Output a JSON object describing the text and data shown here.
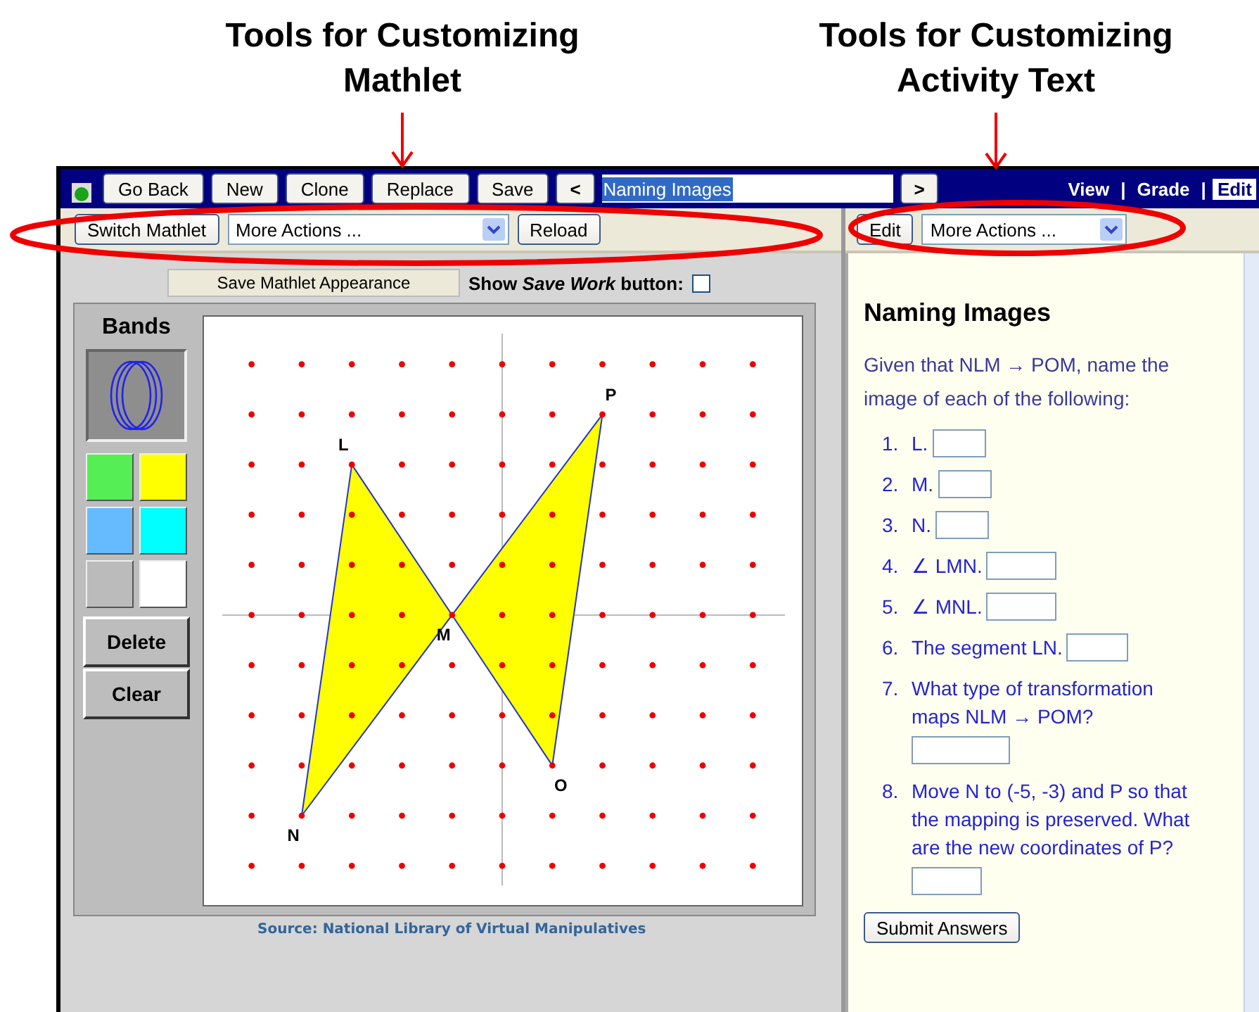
{
  "annotations": [
    {
      "text": "Tools for Customizing Mathlet"
    },
    {
      "text": "Tools for Customizing Activity Text"
    }
  ],
  "nav_bar": {
    "buttons": [
      "Go Back",
      "New",
      "Clone",
      "Replace",
      "Save"
    ],
    "prev": "<",
    "title_field": {
      "value": "Naming Images",
      "selected": true
    },
    "next": ">",
    "links": [
      {
        "label": "View",
        "selected": false
      },
      {
        "label": "Grade",
        "selected": false
      },
      {
        "label": "Edit",
        "selected": true
      }
    ],
    "separator": "|"
  },
  "mathlet_toolbar": {
    "switch_button": "Switch Mathlet",
    "select": "More Actions ...",
    "reload_button": "Reload"
  },
  "activity_toolbar": {
    "edit_button": "Edit",
    "select": "More Actions ..."
  },
  "mathlet": {
    "save_appearance_button": "Save Mathlet Appearance",
    "show_save_work": {
      "label": "Show **Save Work** button:",
      "checked": false
    },
    "palette": {
      "title": "Bands",
      "swatches": [
        {
          "color": "#55ee55"
        },
        {
          "color": "#ffff00"
        },
        {
          "color": "#66bbff"
        },
        {
          "color": "#00ffff"
        },
        {
          "color": "#bbbbbb"
        },
        {
          "color": "#ffffff"
        }
      ],
      "delete_button": "Delete",
      "clear_button": "Clear"
    },
    "points": [
      {
        "label": "L"
      },
      {
        "label": "M"
      },
      {
        "label": "N"
      },
      {
        "label": "O"
      },
      {
        "label": "P"
      }
    ],
    "source": "Source: National Library of Virtual Manipulatives"
  },
  "activity": {
    "title": "Naming Images",
    "intro": "Given that NLM → POM, name the image of each of the following:",
    "questions": [
      {
        "number": "1.",
        "text": "L."
      },
      {
        "number": "2.",
        "text": "M."
      },
      {
        "number": "3.",
        "text": "N."
      },
      {
        "number": "4.",
        "text": "∠ LMN."
      },
      {
        "number": "5.",
        "text": "∠ MNL."
      },
      {
        "number": "6.",
        "text": "The segment LN."
      },
      {
        "number": "7.",
        "text": "What type of transformation maps NLM → POM?"
      },
      {
        "number": "8.",
        "text": "Move N to (-5, -3) and P so that the mapping is preserved. What are the new coordinates of P?"
      }
    ],
    "submit_button": "Submit Answers"
  }
}
